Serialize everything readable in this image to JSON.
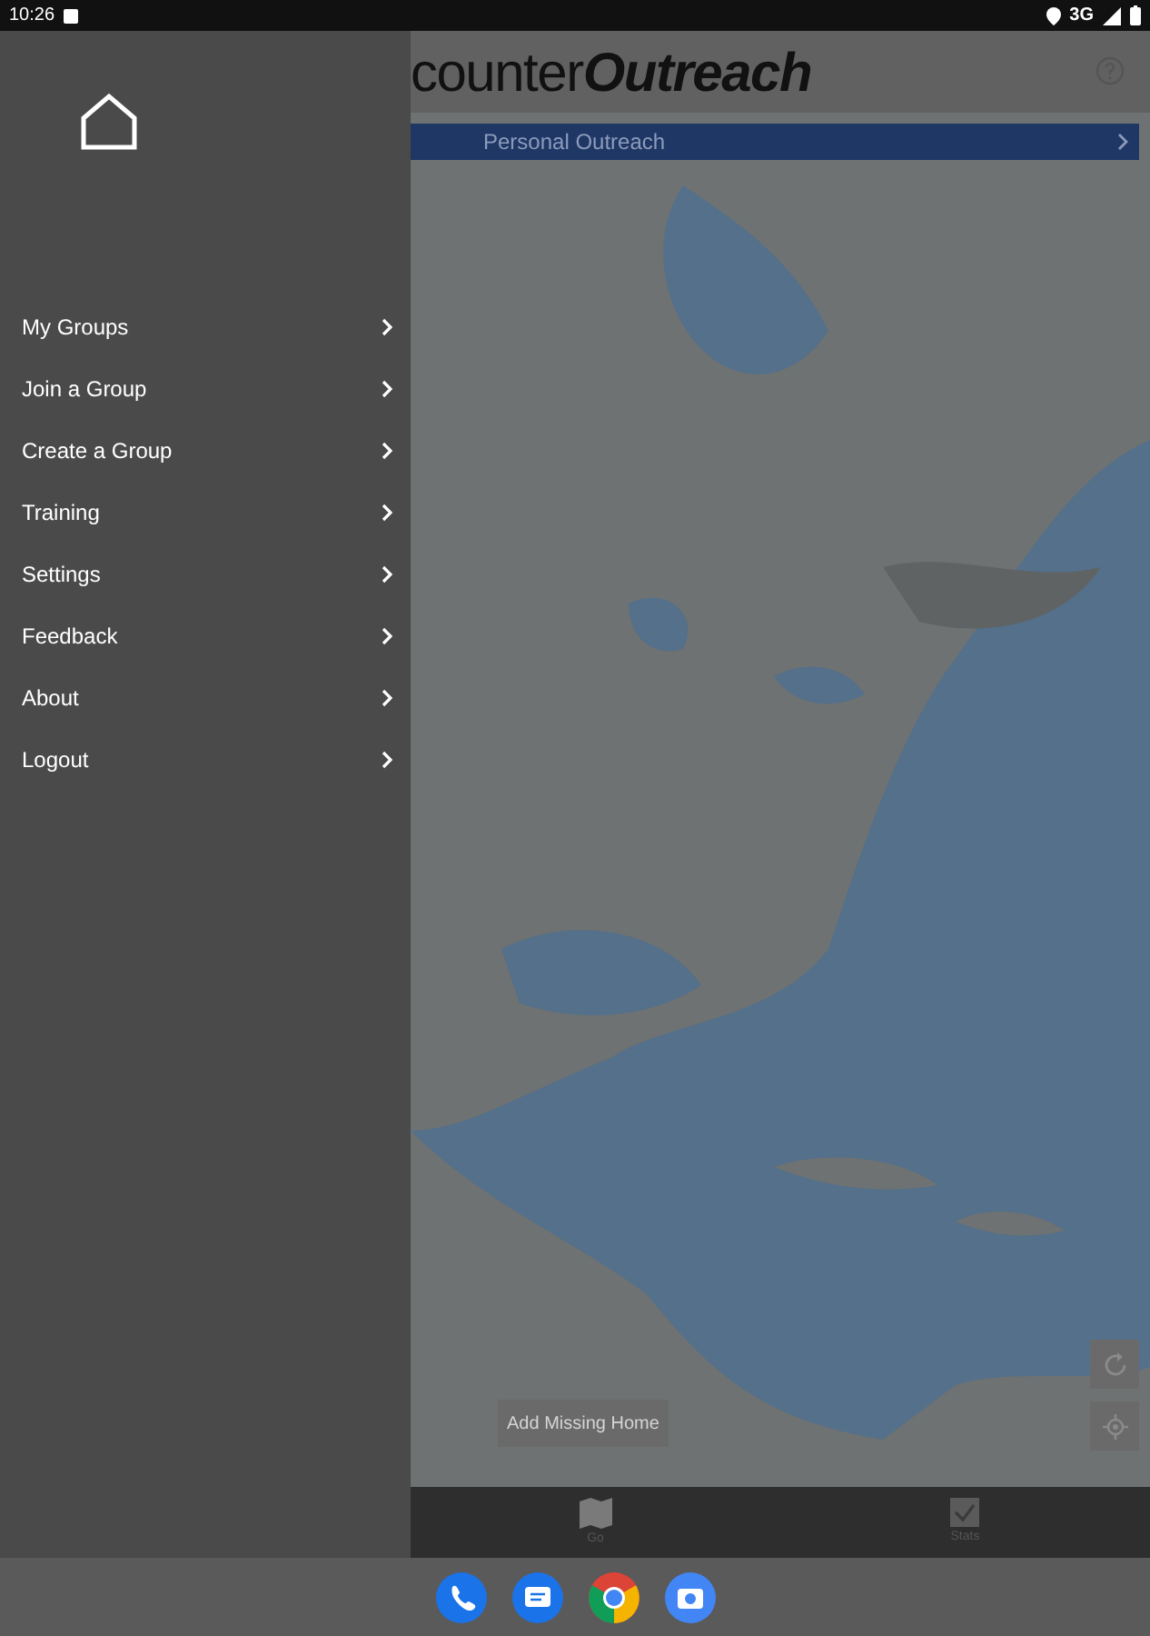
{
  "status_bar": {
    "time": "10:26",
    "network": "3G"
  },
  "header": {
    "title_regular": "counter",
    "title_italic": "Outreach"
  },
  "outreach_bar": {
    "label": "Personal Outreach"
  },
  "map": {
    "add_button": "Add Missing Home"
  },
  "bottom_tabs": [
    {
      "label": "Go",
      "kind": "map"
    },
    {
      "label": "Stats",
      "kind": "check"
    }
  ],
  "drawer": {
    "menu": [
      {
        "label": "My Groups"
      },
      {
        "label": "Join a Group"
      },
      {
        "label": "Create a Group"
      },
      {
        "label": "Training"
      },
      {
        "label": "Settings"
      },
      {
        "label": "Feedback"
      },
      {
        "label": "About"
      },
      {
        "label": "Logout"
      }
    ]
  }
}
